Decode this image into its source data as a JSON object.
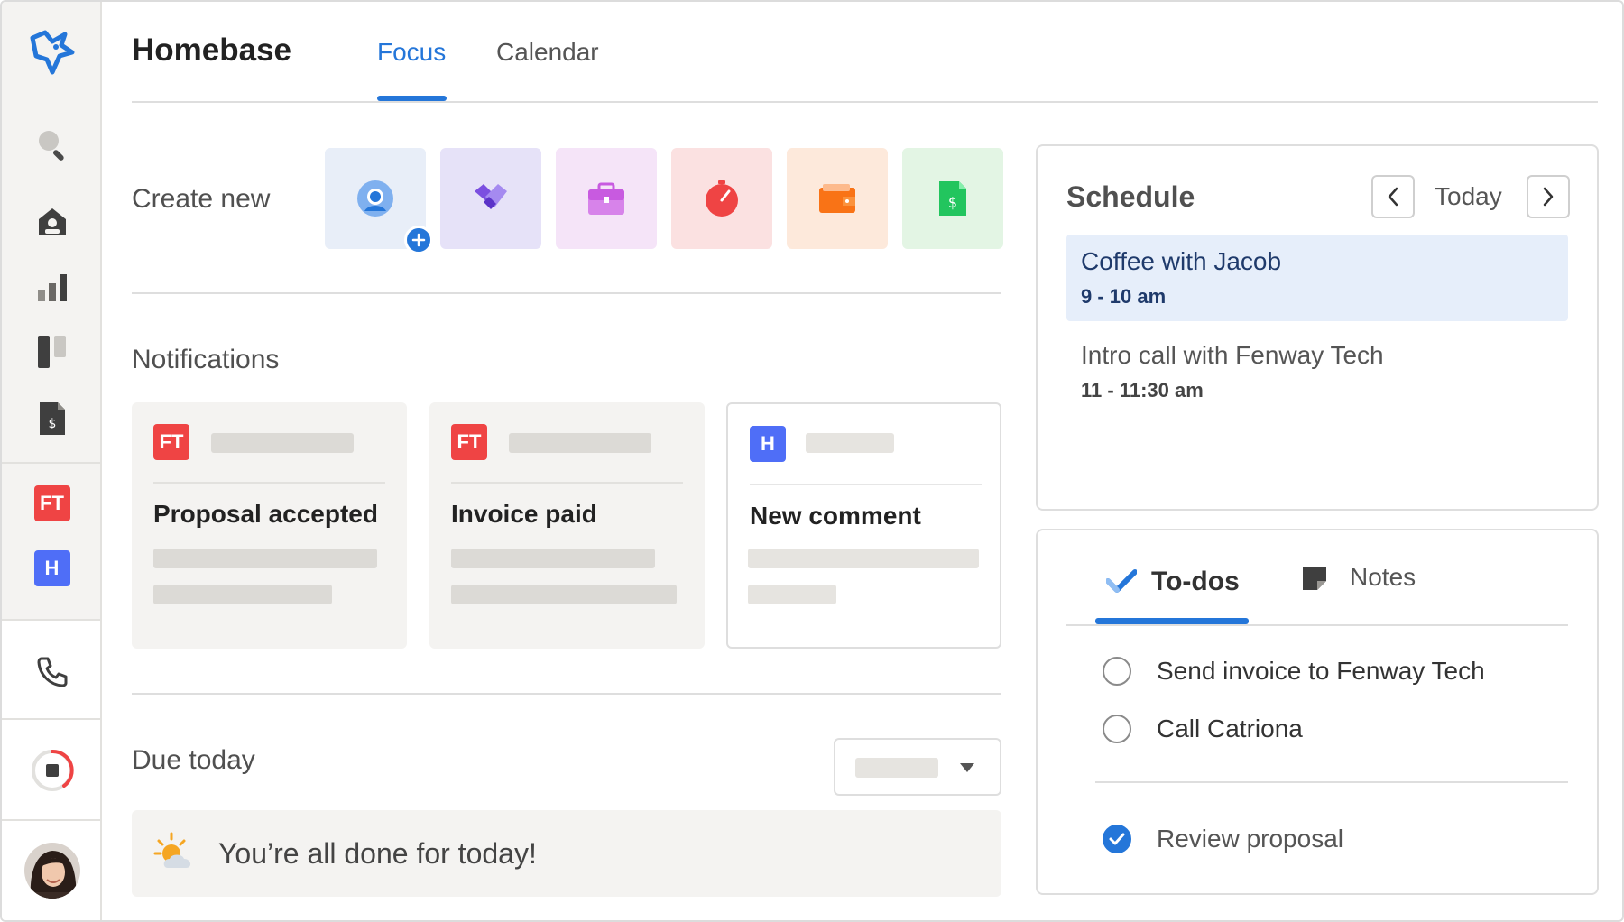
{
  "app": {
    "title": "Homebase"
  },
  "tabs": [
    {
      "label": "Focus",
      "active": true
    },
    {
      "label": "Calendar",
      "active": false
    }
  ],
  "sidebar": {
    "icons": [
      "logo-icon",
      "search-icon",
      "home-icon",
      "chart-icon",
      "board-icon",
      "invoice-icon"
    ],
    "clients": [
      {
        "initials": "FT",
        "color": "#ef4444"
      },
      {
        "initials": "H",
        "color": "#4f6ef7"
      }
    ]
  },
  "create_new": {
    "label": "Create new",
    "items": [
      {
        "icon": "contact-icon",
        "bg": "#e8eef8",
        "color": "#2476d9"
      },
      {
        "icon": "handshake-icon",
        "bg": "#e6e2f8",
        "color": "#7b4fe0"
      },
      {
        "icon": "briefcase-icon",
        "bg": "#f5e4f8",
        "color": "#c85ae0"
      },
      {
        "icon": "timer-icon",
        "bg": "#fbe1e1",
        "color": "#ef4444"
      },
      {
        "icon": "wallet-icon",
        "bg": "#fde9db",
        "color": "#f97316"
      },
      {
        "icon": "invoice-icon",
        "bg": "#e3f5e4",
        "color": "#22c55e"
      }
    ]
  },
  "notifications": {
    "label": "Notifications",
    "items": [
      {
        "badge": "FT",
        "title": "Proposal accepted"
      },
      {
        "badge": "FT",
        "title": "Invoice paid"
      },
      {
        "badge": "H",
        "title": "New comment"
      }
    ]
  },
  "due_today": {
    "label": "Due today",
    "message": "You’re all done for today!"
  },
  "schedule": {
    "title": "Schedule",
    "today_label": "Today",
    "events": [
      {
        "title": "Coffee with Jacob",
        "time": "9 - 10 am",
        "highlighted": true
      },
      {
        "title": "Intro call with Fenway Tech",
        "time": "11 - 11:30 am",
        "highlighted": false
      }
    ]
  },
  "todos": {
    "tabs": [
      {
        "label": "To-dos",
        "active": true
      },
      {
        "label": "Notes",
        "active": false
      }
    ],
    "items": [
      {
        "text": "Send invoice to Fenway Tech",
        "done": false
      },
      {
        "text": "Call Catriona",
        "done": false
      },
      {
        "text": "Review proposal",
        "done": true
      }
    ]
  },
  "colors": {
    "accent": "#2476d9",
    "sidebar_bg": "#f4f3f1",
    "badge_ft": "#ef4444",
    "badge_h": "#4f6ef7"
  }
}
